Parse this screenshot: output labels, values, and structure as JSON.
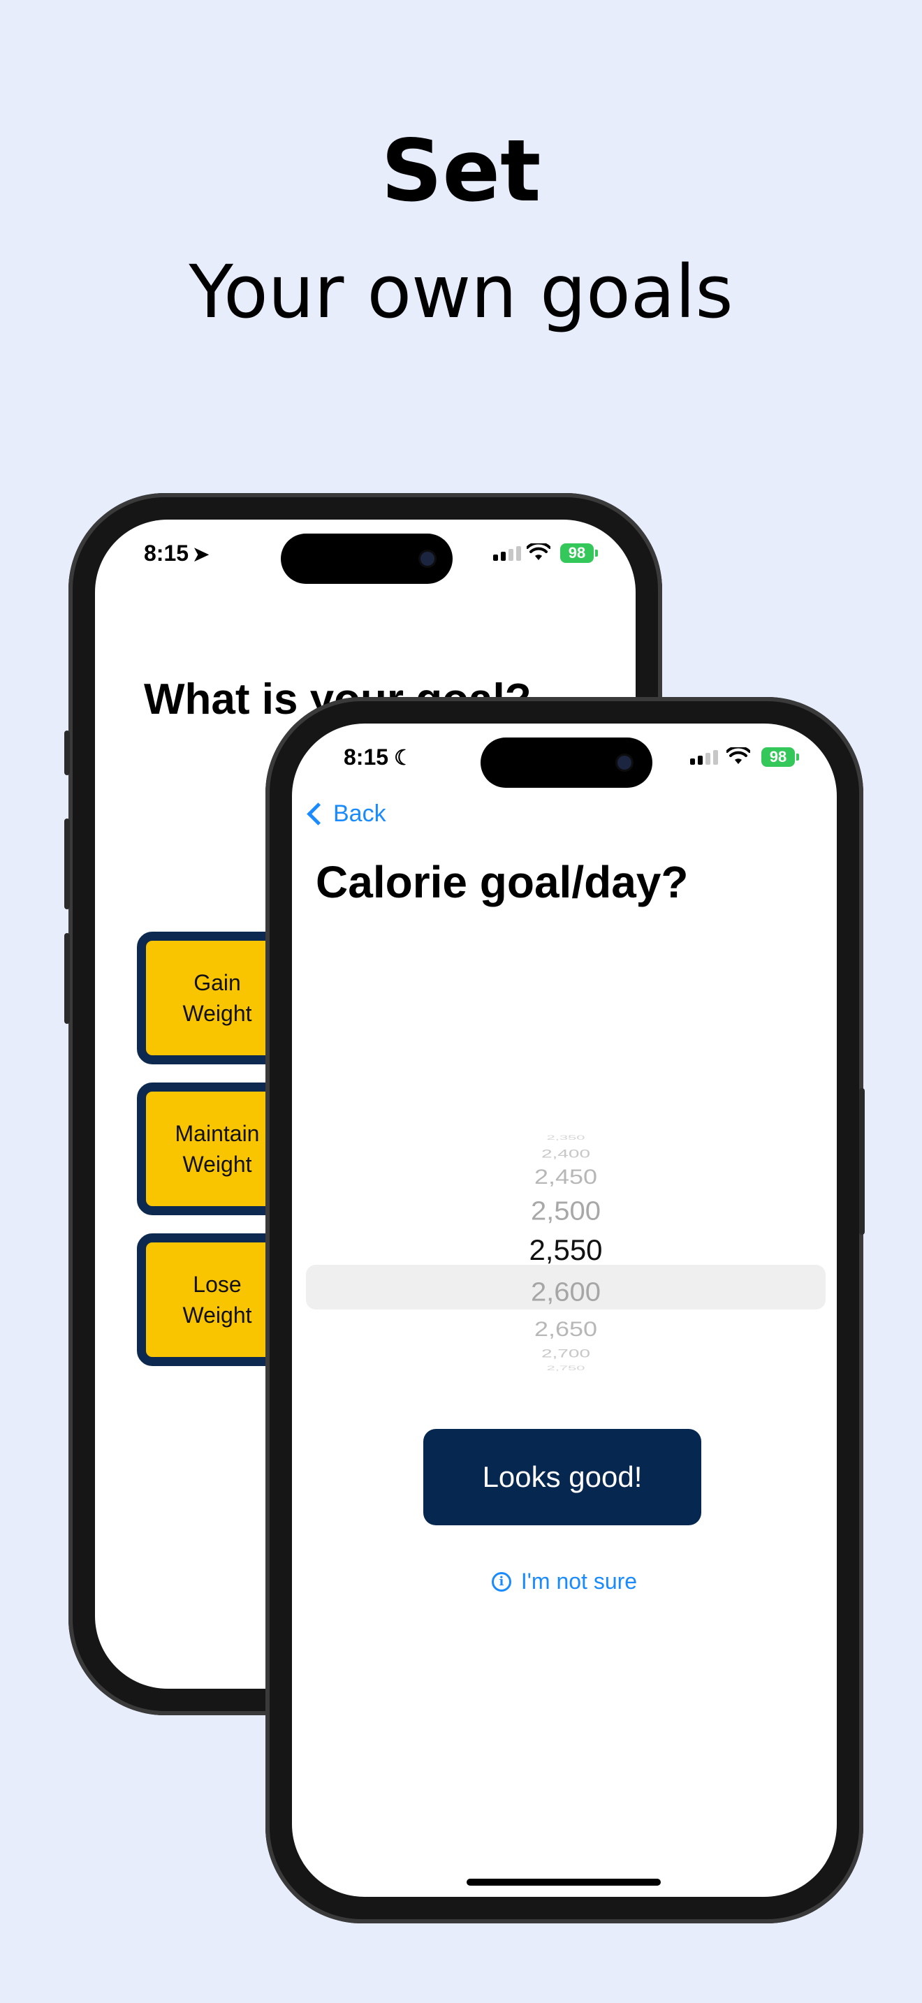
{
  "headline": {
    "line1": "Set",
    "line2": "Your own goals"
  },
  "back_phone": {
    "status_time": "8:15",
    "battery": "98",
    "title": "What is your goal?",
    "options": [
      {
        "line1": "Gain",
        "line2": "Weight"
      },
      {
        "line1": "Maintain",
        "line2": "Weight"
      },
      {
        "line1": "Lose",
        "line2": "Weight"
      }
    ],
    "option_color": "#f9c400",
    "option_border_color": "#0d2950"
  },
  "front_phone": {
    "status_time": "8:15",
    "battery": "98",
    "back_label": "Back",
    "title": "Calorie goal/day?",
    "picker": {
      "values": [
        "2,350",
        "2,400",
        "2,450",
        "2,500",
        "2,550",
        "2,600",
        "2,650",
        "2,700",
        "2,750"
      ],
      "selected": "2,550"
    },
    "primary_button": "Looks good!",
    "primary_color": "#06274f",
    "secondary_link": "I'm not sure",
    "link_color": "#1a8bff"
  },
  "icons": [
    "location-arrow-icon",
    "moon-icon",
    "cellular-signal-icon",
    "wifi-icon",
    "battery-icon",
    "chevron-left-icon",
    "info-icon"
  ]
}
